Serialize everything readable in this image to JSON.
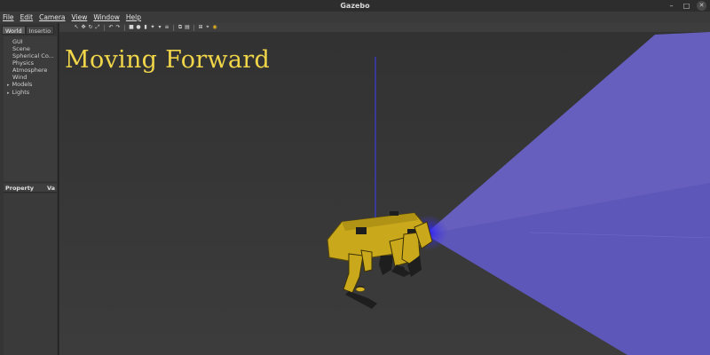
{
  "window": {
    "title": "Gazebo",
    "controls": [
      "–",
      "□",
      "✕"
    ]
  },
  "menu": [
    "File",
    "Edit",
    "Camera",
    "View",
    "Window",
    "Help"
  ],
  "left_panel": {
    "tabs": [
      "World",
      "Insertio"
    ],
    "tree": [
      {
        "label": "GUI",
        "expandable": false
      },
      {
        "label": "Scene",
        "expandable": false
      },
      {
        "label": "Spherical Co...",
        "expandable": false
      },
      {
        "label": "Physics",
        "expandable": false
      },
      {
        "label": "Atmosphere",
        "expandable": false
      },
      {
        "label": "Wind",
        "expandable": false
      },
      {
        "label": "Models",
        "expandable": true
      },
      {
        "label": "Lights",
        "expandable": true
      }
    ],
    "properties": {
      "col1": "Property",
      "col2": "Va"
    }
  },
  "toolbar": {
    "icons": [
      "pointer-icon",
      "translate-icon",
      "rotate-icon",
      "scale-icon",
      "undo-icon",
      "redo-icon",
      "box-icon",
      "sphere-icon",
      "cylinder-icon",
      "light-icon",
      "spot-light-icon",
      "directional-light-icon",
      "copy-icon",
      "paste-icon",
      "align-icon",
      "snap-icon",
      "camera-icon"
    ]
  },
  "viewport": {
    "overlay_text": "Moving Forward",
    "colors": {
      "ground": "#3a3a3a",
      "laser": "#6a63c9",
      "robot": "#c9a81c",
      "overlay": "#f1d64a"
    }
  }
}
